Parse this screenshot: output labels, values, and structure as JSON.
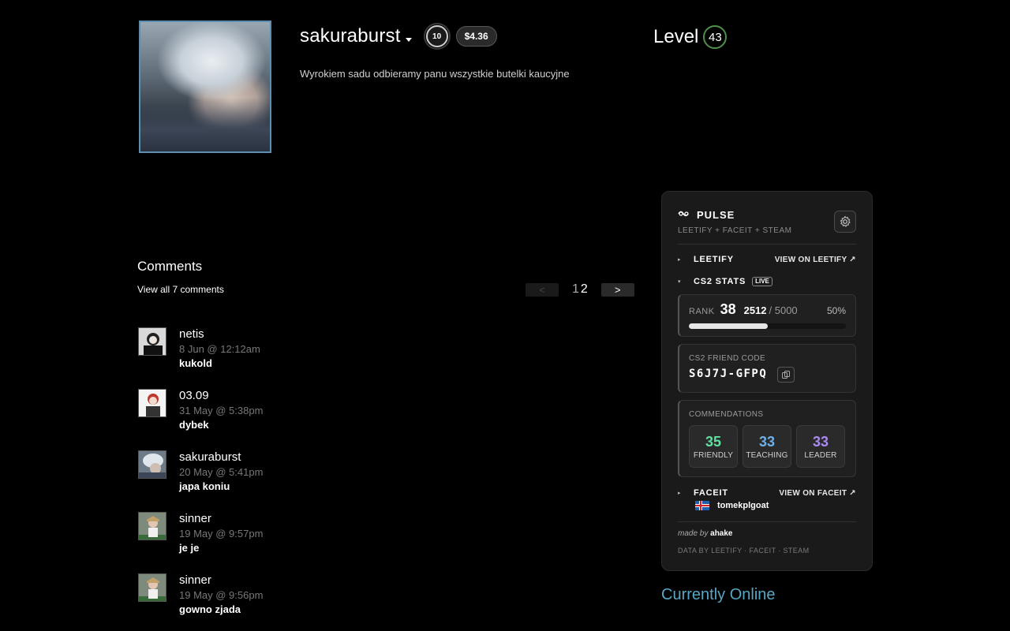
{
  "profile": {
    "persona_name": "sakuraburst",
    "faceit_level": "10",
    "worth": "$4.36",
    "summary": "Wyrokiem sadu odbieramy panu wszystkie butelki kaucyjne",
    "level_label": "Level",
    "level": "43",
    "status": "Currently Online"
  },
  "comments": {
    "title": "Comments",
    "view_all": "View all 7 comments",
    "pager": {
      "prev": "<",
      "next": ">",
      "pages": [
        "1",
        "2"
      ],
      "current": "2"
    },
    "items": [
      {
        "author": "netis",
        "time": "8 Jun @ 12:12am",
        "text": "kukold"
      },
      {
        "author": "03.09",
        "time": "31 May @ 5:38pm",
        "text": "dybek"
      },
      {
        "author": "sakuraburst",
        "time": "20 May @ 5:41pm",
        "text": "japa koniu"
      },
      {
        "author": "sinner",
        "time": "19 May @ 9:57pm",
        "text": "je je"
      },
      {
        "author": "sinner",
        "time": "19 May @ 9:56pm",
        "text": "gowno zjada"
      }
    ]
  },
  "pulse": {
    "title": "PULSE",
    "subtitle": "LEETIFY + FACEIT + STEAM",
    "leetify": {
      "label": "LEETIFY",
      "link": "VIEW ON LEETIFY ↗"
    },
    "cs2": {
      "label": "CS2 STATS",
      "live": "LIVE",
      "rank_label": "RANK",
      "rank": "38",
      "elo": "2512",
      "elo_max": "/ 5000",
      "percent": "50%",
      "progress": 0.5,
      "friend_code_label": "CS2 FRIEND CODE",
      "friend_code": "S6J7J-GFPQ",
      "commendations_label": "COMMENDATIONS",
      "commendations": [
        {
          "value": "35",
          "name": "FRIENDLY",
          "color": "#5ee0a0"
        },
        {
          "value": "33",
          "name": "TEACHING",
          "color": "#6fb0e8"
        },
        {
          "value": "33",
          "name": "LEADER",
          "color": "#a98bf0"
        }
      ]
    },
    "faceit": {
      "label": "FACEIT",
      "link": "VIEW ON FACEIT ↗",
      "user": "tomekplgoat"
    },
    "made_by_prefix": "made by",
    "made_by_author": "ahake",
    "data_by": "DATA BY LEETIFY · FACEIT · STEAM"
  }
}
